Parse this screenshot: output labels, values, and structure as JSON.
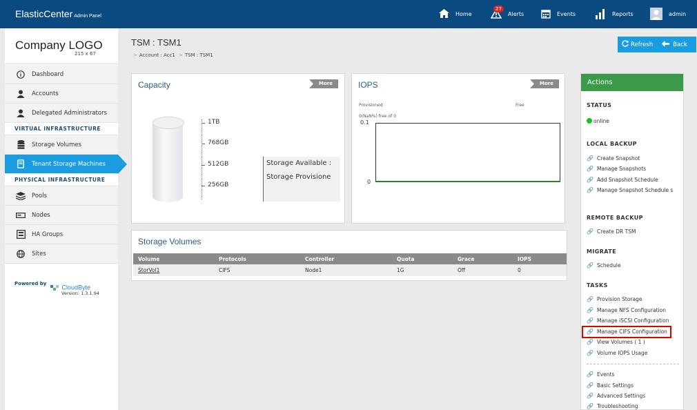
{
  "header": {
    "brand": "ElasticCenter",
    "brand_sub": "Admin Panel",
    "nav": [
      {
        "label": "Home",
        "icon": "home-icon"
      },
      {
        "label": "Alerts",
        "icon": "alert-icon",
        "badge": "27"
      },
      {
        "label": "Events",
        "icon": "calendar-icon"
      },
      {
        "label": "Reports",
        "icon": "bar-chart-icon"
      },
      {
        "label": "admin",
        "icon": "user-avatar-icon"
      }
    ]
  },
  "sidebar": {
    "logo": "Company LOGO",
    "logo_size": "215 x 67",
    "items": [
      {
        "label": "Dashboard",
        "icon": "info-icon"
      },
      {
        "label": "Accounts",
        "icon": "user-icon"
      },
      {
        "label": "Delegated Administrators",
        "icon": "admins-icon"
      },
      {
        "section": "VIRTUAL INFRASTRUCTURE"
      },
      {
        "label": "Storage Volumes",
        "icon": "database-icon"
      },
      {
        "label": "Tenant Storage Machines",
        "icon": "tsm-icon",
        "active": true
      },
      {
        "section": "PHYSICAL INFRASTRUCTURE"
      },
      {
        "label": "Pools",
        "icon": "layers-icon"
      },
      {
        "label": "Nodes",
        "icon": "node-icon"
      },
      {
        "label": "HA Groups",
        "icon": "ha-group-icon"
      },
      {
        "label": "Sites",
        "icon": "globe-icon"
      }
    ],
    "powered_by": "Powered by",
    "powered_logo": "CloudByte",
    "version": "Version: 1.3.1.94"
  },
  "page": {
    "title": "TSM : TSM1",
    "breadcrumb": [
      "Account : Acc1",
      "TSM : TSM1"
    ],
    "refresh_label": "Refresh",
    "back_label": "Back"
  },
  "capacity": {
    "title": "Capacity",
    "more_label": "More",
    "ticks": [
      "1TB",
      "768GB",
      "512GB",
      "256GB"
    ],
    "legend": [
      "Storage Available :",
      "Storage Provisione"
    ]
  },
  "iops": {
    "title": "IOPS",
    "more_label": "More",
    "provisioned_label": "Provisioned",
    "free_label": "Free",
    "summary": "0(NaN%) free of 0",
    "y_top": "0.1",
    "y_bottom": "0"
  },
  "volumes": {
    "title": "Storage Volumes",
    "columns": [
      "Volume",
      "Protocols",
      "Controller",
      "Quota",
      "Grace",
      "IOPS"
    ],
    "rows": [
      [
        "StorVol1",
        "CIFS",
        "Node1",
        "1G",
        "Off",
        "0"
      ]
    ]
  },
  "actions": {
    "title": "Actions",
    "status_title": "STATUS",
    "status_value": "online",
    "status_color": "#18c418",
    "local_backup_title": "LOCAL BACKUP",
    "local_backup": [
      "Create Snapshot",
      "Manage Snapshots",
      "Add Snapshot Schedule",
      "Manage Snapshot Schedule s"
    ],
    "remote_backup_title": "REMOTE BACKUP",
    "remote_backup": [
      "Create DR TSM"
    ],
    "migrate_title": "MIGRATE",
    "migrate": [
      "Schedule"
    ],
    "tasks_title": "TASKS",
    "tasks": [
      "Provision Storage",
      "Manage NFS Configuration",
      "Manage iSCSI Configuration",
      "Manage CIFS Configuration",
      "View Volumes ( 1 )",
      "Volume IOPS Usage"
    ],
    "other": [
      "Events",
      "Basic Settings",
      "Advanced Settings",
      "Troubleshooting"
    ]
  }
}
